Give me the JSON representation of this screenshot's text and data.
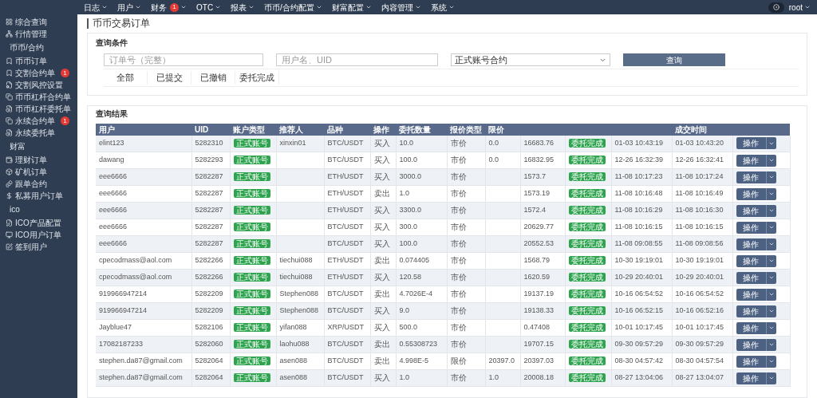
{
  "top_nav": {
    "menus": [
      {
        "label": "日志"
      },
      {
        "label": "用户"
      },
      {
        "label": "财务",
        "badge": "1"
      },
      {
        "label": "OTC"
      },
      {
        "label": "报表"
      },
      {
        "label": "币币/合约配置"
      },
      {
        "label": "财富配置"
      },
      {
        "label": "内容管理"
      },
      {
        "label": "系统"
      }
    ],
    "user": "root"
  },
  "sidebar": {
    "groups": [
      {
        "items": [
          {
            "label": "综合查询"
          },
          {
            "label": "行情管理"
          }
        ]
      },
      {
        "title": "币币/合约",
        "items": [
          {
            "label": "币币订单"
          },
          {
            "label": "交割合约单",
            "badge": "1"
          },
          {
            "label": "交割风控设置"
          },
          {
            "label": "币币杠杆合约单"
          },
          {
            "label": "币币杠杆委托单"
          },
          {
            "label": "永续合约单",
            "badge": "1"
          },
          {
            "label": "永续委托单"
          }
        ]
      },
      {
        "title": "财富",
        "items": [
          {
            "label": "理财订单"
          },
          {
            "label": "矿机订单"
          },
          {
            "label": "跟单合约"
          },
          {
            "label": "私募用户订单"
          }
        ]
      },
      {
        "title": "ico",
        "items": [
          {
            "label": "ICO产品配置"
          },
          {
            "label": "ICO用户订单"
          },
          {
            "label": "签到用户"
          }
        ]
      }
    ]
  },
  "page_title": "币币交易订单",
  "query": {
    "title": "查询条件",
    "order_field": {
      "placeholder": "订单号（完整）"
    },
    "user_field": {
      "placeholder": "用户名、UID"
    },
    "account_select": {
      "value": "正式账号合约"
    },
    "search_button": "查询",
    "tabs": [
      {
        "label": "全部"
      },
      {
        "label": "已提交"
      },
      {
        "label": "已撤销"
      },
      {
        "label": "委托完成"
      }
    ]
  },
  "results": {
    "title": "查询结果",
    "columns": [
      {
        "label": "用户",
        "kind": "text"
      },
      {
        "label": "UID",
        "kind": "text"
      },
      {
        "label": "账户类型",
        "kind": "badge"
      },
      {
        "label": "推荐人",
        "kind": "text"
      },
      {
        "label": "品种",
        "kind": "text"
      },
      {
        "label": "操作",
        "kind": "text"
      },
      {
        "label": "委托数量",
        "kind": "text"
      },
      {
        "label": "报价类型",
        "kind": "text"
      },
      {
        "label": "限价",
        "kind": "text"
      },
      {
        "kind": "text"
      },
      {
        "kind": "badge"
      },
      {
        "kind": "text"
      },
      {
        "label": "成交时间",
        "kind": "text"
      },
      {
        "kind": "action"
      }
    ],
    "rows": [
      [
        "elint123",
        "5282310",
        "正式账号",
        "xinxin01",
        "BTC/USDT",
        "买入",
        "10.0",
        "市价",
        "0.0",
        "16683.76",
        "委托完成",
        "01-03 10:43:19",
        "01-03 10:43:20",
        "操作"
      ],
      [
        "dawang",
        "5282293",
        "正式账号",
        null,
        "BTC/USDT",
        "买入",
        "100.0",
        "市价",
        "0.0",
        "16832.95",
        "委托完成",
        "12-26 16:32:39",
        "12-26 16:32:41",
        "操作"
      ],
      [
        "eee6666",
        "5282287",
        "正式账号",
        null,
        "ETH/USDT",
        "买入",
        "3000.0",
        "市价",
        null,
        "1573.7",
        "委托完成",
        "11-08 10:17:23",
        "11-08 10:17:24",
        "操作"
      ],
      [
        "eee6666",
        "5282287",
        "正式账号",
        null,
        "ETH/USDT",
        "卖出",
        "1.0",
        "市价",
        null,
        "1573.19",
        "委托完成",
        "11-08 10:16:48",
        "11-08 10:16:49",
        "操作"
      ],
      [
        "eee6666",
        "5282287",
        "正式账号",
        null,
        "ETH/USDT",
        "买入",
        "3300.0",
        "市价",
        null,
        "1572.4",
        "委托完成",
        "11-08 10:16:29",
        "11-08 10:16:30",
        "操作"
      ],
      [
        "eee6666",
        "5282287",
        "正式账号",
        null,
        "BTC/USDT",
        "买入",
        "300.0",
        "市价",
        null,
        "20629.77",
        "委托完成",
        "11-08 10:16:15",
        "11-08 10:16:15",
        "操作"
      ],
      [
        "eee6666",
        "5282287",
        "正式账号",
        null,
        "BTC/USDT",
        "买入",
        "100.0",
        "市价",
        null,
        "20552.53",
        "委托完成",
        "11-08 09:08:55",
        "11-08 09:08:56",
        "操作"
      ],
      [
        "cpecodmass@aol.com",
        "5282266",
        "正式账号",
        "tiechui088",
        "ETH/USDT",
        "卖出",
        "0.074405",
        "市价",
        null,
        "1568.79",
        "委托完成",
        "10-30 19:19:01",
        "10-30 19:19:01",
        "操作"
      ],
      [
        "cpecodmass@aol.com",
        "5282266",
        "正式账号",
        "tiechui088",
        "ETH/USDT",
        "买入",
        "120.58",
        "市价",
        null,
        "1620.59",
        "委托完成",
        "10-29 20:40:01",
        "10-29 20:40:01",
        "操作"
      ],
      [
        "919966947214",
        "5282209",
        "正式账号",
        "Stephen088",
        "BTC/USDT",
        "卖出",
        "4.7026E-4",
        "市价",
        null,
        "19137.19",
        "委托完成",
        "10-16 06:54:52",
        "10-16 06:54:52",
        "操作"
      ],
      [
        "919966947214",
        "5282209",
        "正式账号",
        "Stephen088",
        "BTC/USDT",
        "买入",
        "9.0",
        "市价",
        null,
        "19138.33",
        "委托完成",
        "10-16 06:52:15",
        "10-16 06:52:16",
        "操作"
      ],
      [
        "Jayblue47",
        "5282106",
        "正式账号",
        "yifan088",
        "XRP/USDT",
        "买入",
        "500.0",
        "市价",
        null,
        "0.47408",
        "委托完成",
        "10-01 10:17:45",
        "10-01 10:17:45",
        "操作"
      ],
      [
        "17082187233",
        "5282060",
        "正式账号",
        "laohu088",
        "BTC/USDT",
        "卖出",
        "0.55308723",
        "市价",
        null,
        "19707.15",
        "委托完成",
        "09-30 09:57:29",
        "09-30 09:57:29",
        "操作"
      ],
      [
        "stephen.da87@gmail.com",
        "5282064",
        "正式账号",
        "asen088",
        "BTC/USDT",
        "卖出",
        "4.998E-5",
        "限价",
        "20397.0",
        "20397.03",
        "委托完成",
        "08-30 04:57:42",
        "08-30 04:57:54",
        "操作"
      ],
      [
        "stephen.da87@gmail.com",
        "5282064",
        "正式账号",
        "asen088",
        "BTC/USDT",
        "买入",
        "1.0",
        "市价",
        "1.0",
        "20008.18",
        "委托完成",
        "08-27 13:04:06",
        "08-27 13:04:07",
        "操作"
      ]
    ]
  }
}
